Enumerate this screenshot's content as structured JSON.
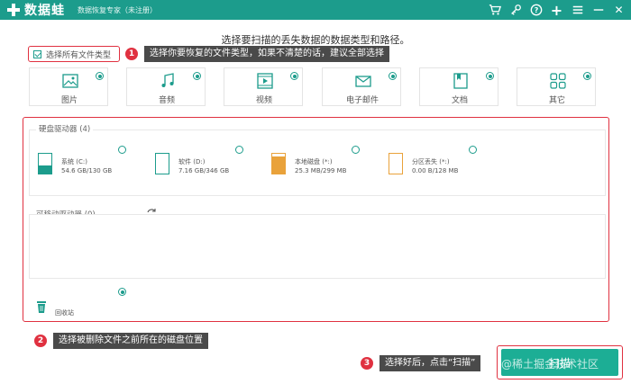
{
  "titlebar": {
    "logo_text": "数据蛙",
    "app_title": "数据恢复专家（未注册）",
    "icons": [
      "cart-icon",
      "key-icon",
      "help-icon",
      "plus-icon",
      "menu-icon",
      "minimize-icon",
      "close-icon"
    ],
    "help_glyph": "?",
    "plus_glyph": "+",
    "close_glyph": "✕"
  },
  "instruction": "选择要扫描的丢失数据的数据类型和路径。",
  "select_all": {
    "label": "选择所有文件类型",
    "checked": true
  },
  "steps": [
    {
      "number": "1",
      "tip": "选择你要恢复的文件类型，如果不清楚的话，建议全部选择"
    },
    {
      "number": "2",
      "tip": "选择被删除文件之前所在的磁盘位置"
    },
    {
      "number": "3",
      "tip": "选择好后，点击“扫描”"
    }
  ],
  "file_types": [
    {
      "label": "图片",
      "icon": "image-icon",
      "selected": true
    },
    {
      "label": "音频",
      "icon": "music-icon",
      "selected": true
    },
    {
      "label": "视频",
      "icon": "video-icon",
      "selected": true
    },
    {
      "label": "电子邮件",
      "icon": "email-icon",
      "selected": true
    },
    {
      "label": "文档",
      "icon": "document-icon",
      "selected": true
    },
    {
      "label": "其它",
      "icon": "others-icon",
      "selected": true
    }
  ],
  "hard_drives": {
    "title": "硬盘驱动器 (4)",
    "items": [
      {
        "name": "系统 (C:)",
        "size": "54.6 GB/130 GB",
        "usage": 0.42,
        "color": "#1c9c8c",
        "selected": false
      },
      {
        "name": "软件 (D:)",
        "size": "7.16 GB/346 GB",
        "usage": 0.02,
        "color": "#1c9c8c",
        "selected": false
      },
      {
        "name": "本地磁盘 (*:)",
        "size": "25.3 MB/299 MB",
        "usage": 0.85,
        "color": "#e9a23b",
        "selected": false
      },
      {
        "name": "分区丢失 (*:)",
        "size": "0.00  B/128 MB",
        "usage": 0.0,
        "color": "#e9a23b",
        "selected": false
      }
    ]
  },
  "removable_drives": {
    "title": "可移动驱动器 (0)"
  },
  "recycle_bin": {
    "label": "回收站",
    "selected": true
  },
  "scan_button": {
    "label": "扫描",
    "watermark": "@稀土掘金技术社区"
  }
}
